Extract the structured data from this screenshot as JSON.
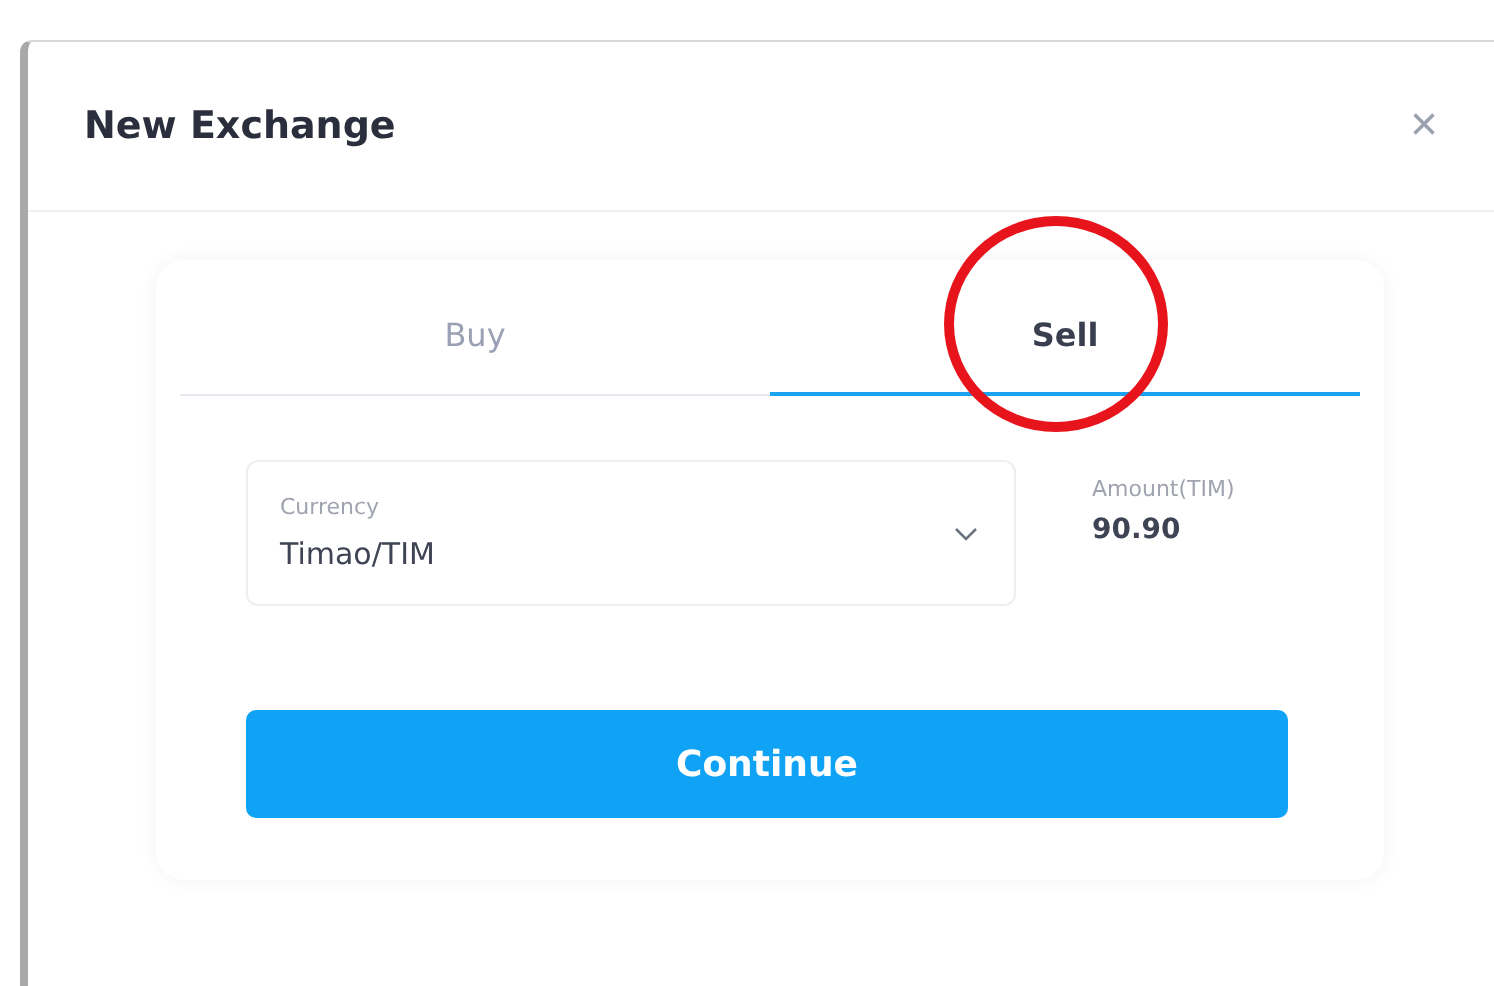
{
  "dialog": {
    "title": "New Exchange",
    "close_icon": "×"
  },
  "tabs": [
    {
      "label": "Buy",
      "selected": false
    },
    {
      "label": "Sell",
      "selected": true
    }
  ],
  "currency": {
    "label": "Currency",
    "value": "Timao/TIM"
  },
  "amount": {
    "label": "Amount(TIM)",
    "value": "90.90"
  },
  "button": "Continue",
  "annotation": {
    "kind": "circle",
    "color": "#e8141b"
  }
}
